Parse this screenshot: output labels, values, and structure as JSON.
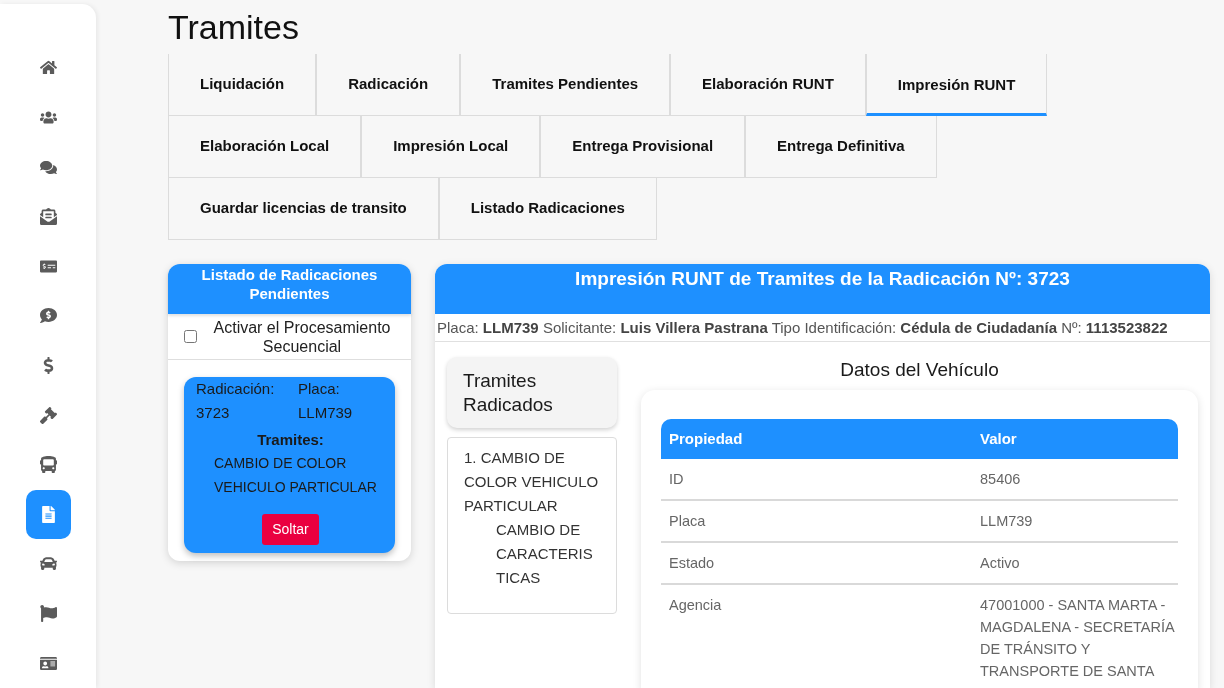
{
  "sidebar": {
    "items": [
      {
        "selected": false
      },
      {
        "selected": false
      },
      {
        "selected": false
      },
      {
        "selected": false
      },
      {
        "selected": false
      },
      {
        "selected": false
      },
      {
        "selected": false
      },
      {
        "selected": false
      },
      {
        "selected": false
      },
      {
        "selected": true
      },
      {
        "selected": false
      },
      {
        "selected": false
      },
      {
        "selected": false
      }
    ]
  },
  "page_title": "Tramites",
  "tab_rows": [
    [
      {
        "label": "Liquidación",
        "selected": false
      },
      {
        "label": "Radicación",
        "selected": false
      },
      {
        "label": "Tramites Pendientes",
        "selected": false
      },
      {
        "label": "Elaboración RUNT",
        "selected": false
      },
      {
        "label": "Impresión RUNT",
        "selected": true
      }
    ],
    [
      {
        "label": "Elaboración Local",
        "selected": false
      },
      {
        "label": "Impresión Local",
        "selected": false
      },
      {
        "label": "Entrega Provisional",
        "selected": false
      },
      {
        "label": "Entrega Definitiva",
        "selected": false
      }
    ],
    [
      {
        "label": "Guardar licencias de transito",
        "selected": false
      },
      {
        "label": "Listado Radicaciones",
        "selected": false
      }
    ]
  ],
  "pending_panel": {
    "title": "Listado de Radicaciones Pendientes",
    "sequential": {
      "label": "Activar el Procesamiento Secuencial",
      "checked": false
    },
    "cards": [
      {
        "fields": [
          {
            "label": "Radicación:",
            "value": "3723"
          },
          {
            "label": "Placa:",
            "value": "LLM739"
          }
        ],
        "tramites_label": "Tramites:",
        "tramites": [
          "CAMBIO DE COLOR VEHICULO PARTICULAR"
        ],
        "button": "Soltar"
      }
    ]
  },
  "print_panel": {
    "title": "Impresión RUNT de Tramites de la Radicación Nº: 3723",
    "info": "Placa: **LLM739** Solicitante: **Luis Villera Pastrana** Tipo Identificación: **Cédula de Ciudadanía** Nº: **1113523822**",
    "tramites_heading": "Tramites Radicados",
    "tramites": [
      {
        "text": "1. CAMBIO DE COLOR VEHICULO PARTICULAR",
        "children": [
          {
            "text": "CAMBIO DE CARACTERISTICAS"
          }
        ]
      }
    ],
    "vehicle": {
      "title": "Datos del Vehículo",
      "columns": [
        "Propiedad",
        "Valor"
      ],
      "rows": [
        [
          "ID",
          "85406"
        ],
        [
          "Placa",
          "LLM739"
        ],
        [
          "Estado",
          "Activo"
        ],
        [
          "Agencia",
          "47001000 - SANTA MARTA - MAGDALENA - SECRETARÍA DE TRÁNSITO Y TRANSPORTE DE SANTA"
        ]
      ]
    }
  }
}
